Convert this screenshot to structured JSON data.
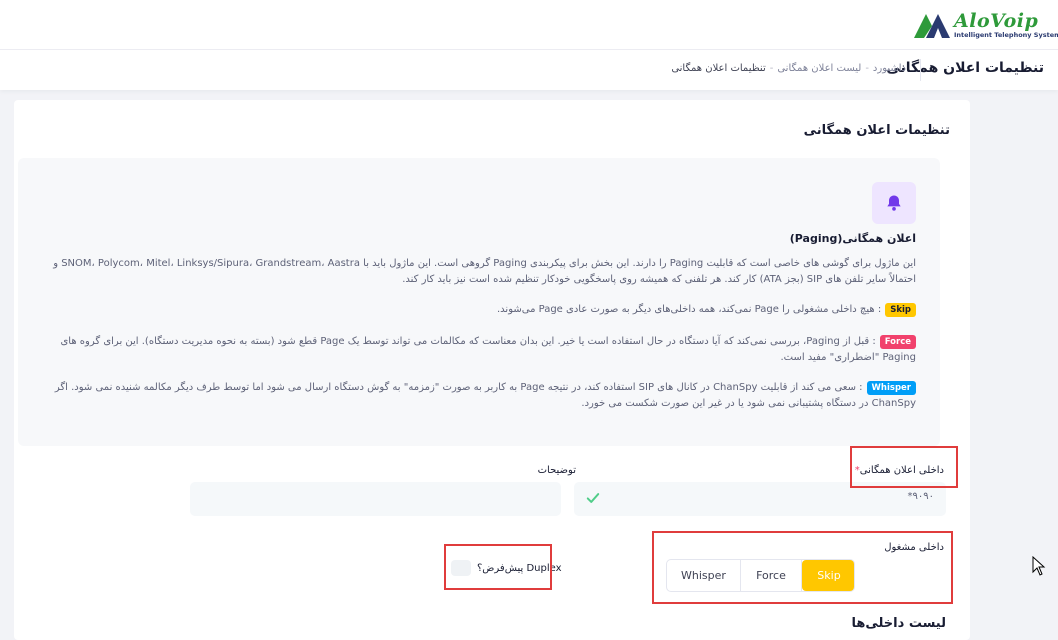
{
  "brand": {
    "name": "AloVoip",
    "tagline": "Intelligent Telephony System"
  },
  "header": {
    "page_title": "تنظیمات اعلان همگانی",
    "breadcrumb": [
      "داشبورد",
      "لیست اعلان همگانی",
      "تنظیمات اعلان همگانی"
    ],
    "breadcrumb_sep": "-"
  },
  "card": {
    "title": "تنظیمات اعلان همگانی"
  },
  "info": {
    "icon": "bell-icon",
    "heading": "اعلان همگانی(Paging)",
    "p1": "این ماژول برای گوشی های خاصی است که قابلیت Paging را دارند. این بخش برای پیکربندی Paging گروهی است. این ماژول باید با SNOM، Polycom، Mitel، Linksys/Sipura، Grandstream، Aastra و احتمالاً سایر تلفن های SIP (بجز ATA) کار کند. هر تلفنی که همیشه روی پاسخگویی خودکار تنظیم شده است نیز باید کار کند.",
    "skip_badge": "Skip",
    "p2": ": هیچ داخلی مشغولی را Page نمی‌کند، همه داخلی‌های دیگر به صورت عادی Page می‌شوند.",
    "force_badge": "Force",
    "p3": ": قبل از Paging، بررسی نمی‌کند که آیا دستگاه در حال استفاده است یا خیر. این بدان معناست که مکالمات می تواند توسط یک Page قطع شود (بسته به نحوه مدیریت دستگاه). این برای گروه های Paging \"اضطراری\" مفید است.",
    "whisper_badge": "Whisper",
    "p4": ": سعی می کند از قابلیت ChanSpy در کانال های SIP استفاده کند، در نتیجه Page به کاربر به صورت \"زمزمه\" به گوش دستگاه ارسال می شود اما توسط طرف دیگر مکالمه شنیده نمی شود. اگر ChanSpy در دستگاه پشتیبانی نمی شود یا در غیر این صورت شکست می خورد."
  },
  "form": {
    "ext_label": "داخلی اعلان همگانی",
    "required_mark": "*",
    "ext_value": "۹۰۹۰*",
    "desc_label": "توضیحات",
    "desc_value": "",
    "busy_label": "داخلی مشغول",
    "busy_options": [
      "Whisper",
      "Force",
      "Skip"
    ],
    "busy_selected": "Skip",
    "duplex_label": "Duplex پیش‌فرض؟"
  },
  "list": {
    "title": "لیست داخلی‌ها"
  },
  "colors": {
    "accent": "#ffc700",
    "danger": "#f1416c",
    "info": "#009ef7",
    "success": "#50cd89",
    "highlight": "#e03c3c"
  }
}
